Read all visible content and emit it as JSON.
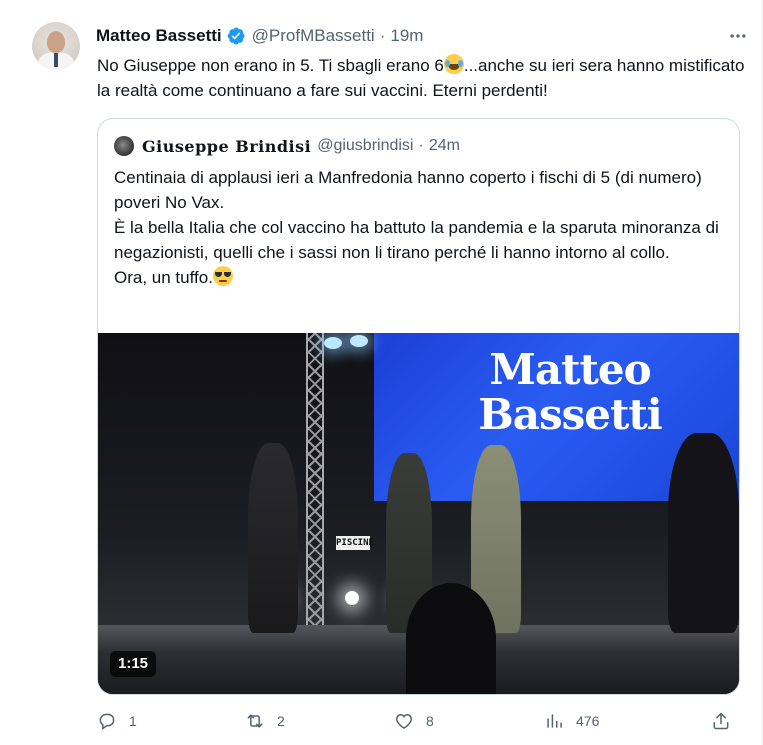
{
  "tweet": {
    "author_name": "Matteo Bassetti",
    "handle": "@ProfMBassetti",
    "separator": "·",
    "time": "19m",
    "text_part1": "No Giuseppe non erano in 5. Ti sbagli erano 6",
    "text_part2": "...anche su ieri sera hanno mistificato la realtà come continuano a fare sui vaccini. Eterni perdenti!"
  },
  "quote": {
    "author_name": "Giuseppe Brindisi",
    "handle": "@giusbrindisi",
    "separator": "·",
    "time": "24m",
    "line1": "Centinaia di applausi ieri a Manfredonia hanno coperto i fischi di 5 (di numero) poveri No Vax.",
    "line2": "È la bella Italia che col vaccino ha battuto la pandemia e la sparuta minoranza di negazionisti, quelli che i sassi non li tirano perché li hanno intorno al collo.",
    "line3": "Ora, un tuffo.",
    "media": {
      "screen_line1": "Matteo",
      "screen_line2": "Bassetti",
      "sign_text": "PISCINE",
      "duration": "1:15"
    }
  },
  "actions": {
    "replies": "1",
    "reposts": "2",
    "likes": "8",
    "views": "476"
  },
  "colors": {
    "text_primary": "#0f1419",
    "text_secondary": "#536471",
    "verified_blue": "#1d9bf0",
    "border": "#cfd9de"
  },
  "icons": [
    "verified-badge-icon",
    "more-icon",
    "laughing-emoji-icon",
    "sunglasses-emoji-icon",
    "reply-icon",
    "repost-icon",
    "like-icon",
    "views-icon",
    "share-icon"
  ]
}
